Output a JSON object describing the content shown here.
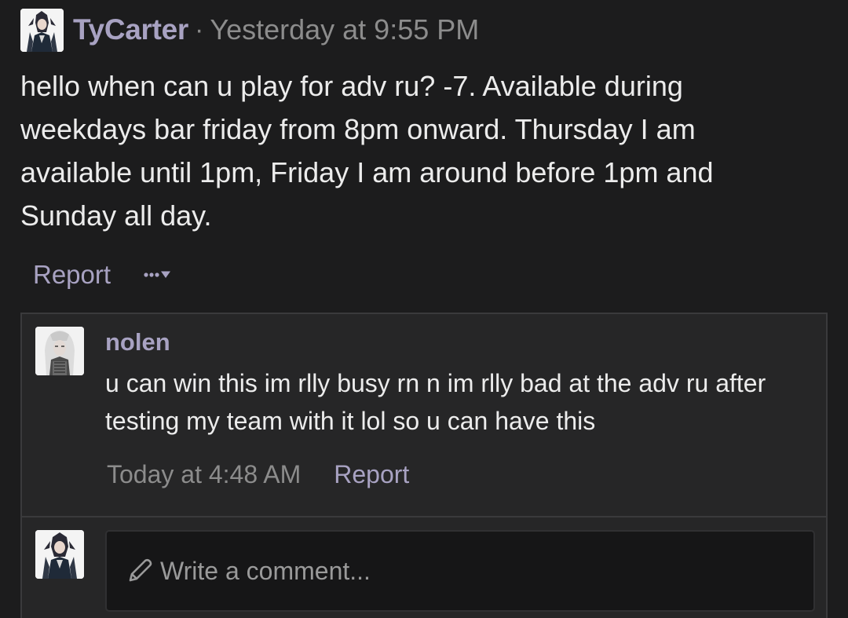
{
  "post": {
    "author": "TyCarter",
    "separator": "·",
    "timestamp": "Yesterday at 9:55 PM",
    "body": "hello when can u play for adv ru? -7. Available during weekdays bar friday from 8pm onward. Thursday I am available until 1pm, Friday I am around before 1pm and Sunday all day.",
    "actions": {
      "report_label": "Report",
      "more_icon": "ellipsis-icon",
      "dropdown_icon": "caret-down-icon"
    }
  },
  "comments": [
    {
      "author": "nolen",
      "text": "u can win this im rlly busy rn n im rlly bad at the adv ru after testing my team with it lol so u can have this",
      "timestamp": "Today at 4:48 AM",
      "report_label": "Report"
    }
  ],
  "composer": {
    "placeholder": "Write a comment...",
    "icon": "pencil-icon"
  },
  "colors": {
    "background": "#1c1c1d",
    "panel": "#262627",
    "accent": "#a8a2c2",
    "muted": "#8c8c8c",
    "text": "#ececec"
  }
}
